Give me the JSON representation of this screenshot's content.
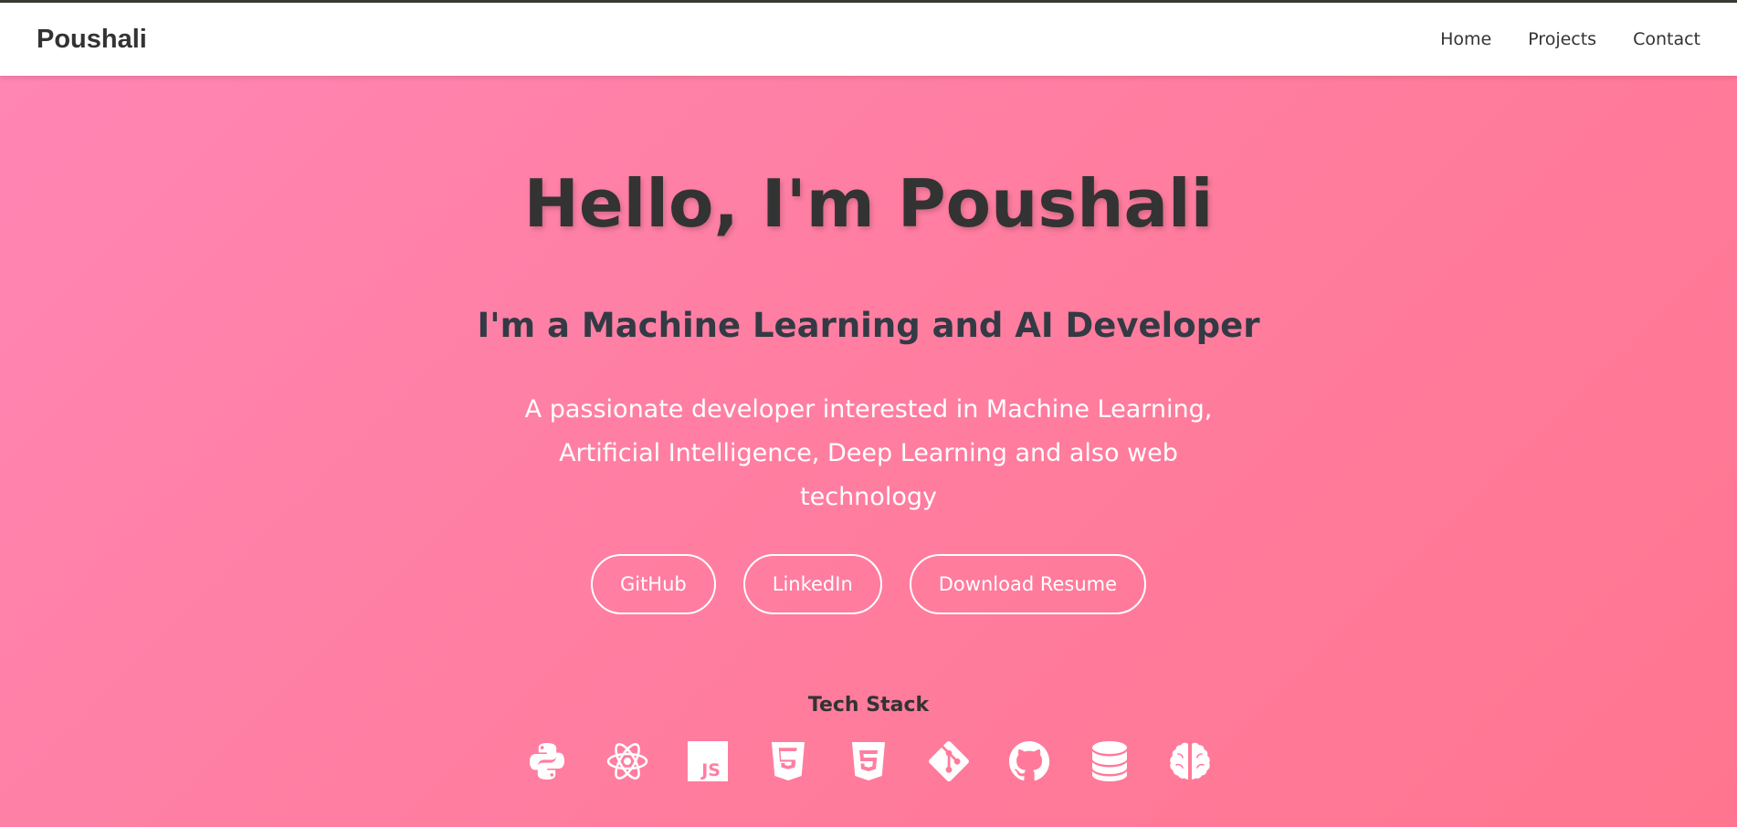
{
  "brand": {
    "name": "Poushali"
  },
  "nav": {
    "items": [
      {
        "label": "Home"
      },
      {
        "label": "Projects"
      },
      {
        "label": "Contact"
      }
    ]
  },
  "hero": {
    "title": "Hello, I'm Poushali",
    "subtitle": "I'm a Machine Learning and AI Developer",
    "description": "A passionate developer interested in Machine Learning, Artificial Intelligence, Deep Learning and also web technology",
    "buttons": [
      {
        "label": "GitHub"
      },
      {
        "label": "LinkedIn"
      },
      {
        "label": "Download Resume"
      }
    ]
  },
  "tech_stack": {
    "title": "Tech Stack",
    "icons": [
      "python-icon",
      "react-icon",
      "javascript-icon",
      "html5-icon",
      "css3-icon",
      "git-icon",
      "github-icon",
      "database-icon",
      "brain-icon"
    ]
  },
  "colors": {
    "top_border": "#3a3a33",
    "navbar_bg": "#ffffff",
    "hero_gradient_start": "#ff85b3",
    "hero_gradient_end": "#ff7590",
    "dark_text": "#333333",
    "light_text": "#ffffff"
  }
}
